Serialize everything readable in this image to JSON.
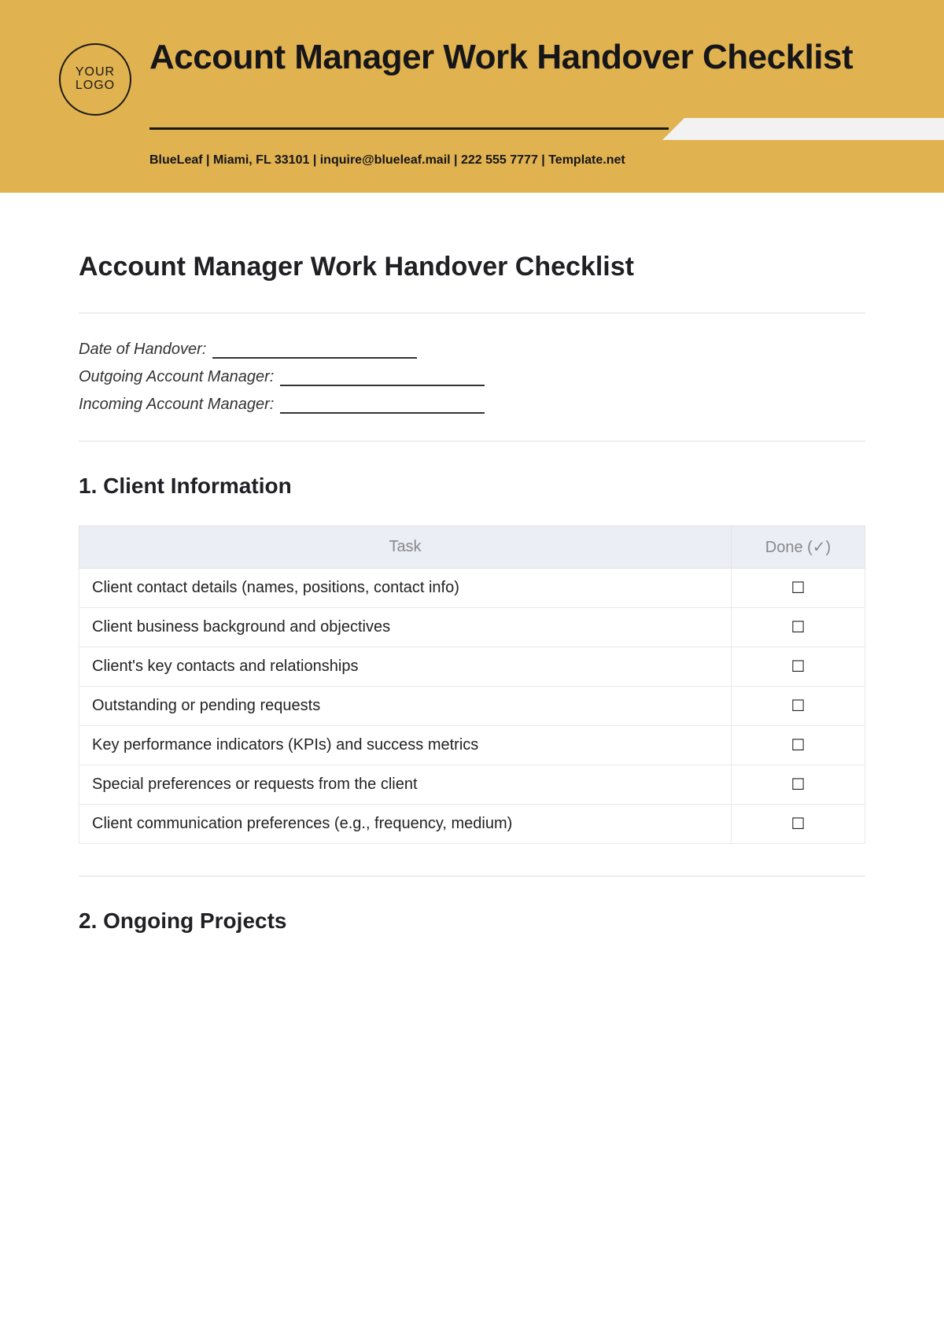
{
  "banner": {
    "logo_top": "YOUR",
    "logo_bottom": "LOGO",
    "title": "Account Manager Work Handover Checklist",
    "contact": "BlueLeaf  |  Miami, FL 33101  |  inquire@blueleaf.mail | 222 555 7777 | Template.net"
  },
  "doc": {
    "title": "Account Manager Work Handover Checklist",
    "meta": {
      "date_label": "Date of Handover:",
      "outgoing_label": "Outgoing Account Manager:",
      "incoming_label": "Incoming Account Manager:"
    },
    "table_headers": {
      "task": "Task",
      "done": "Done (✓)"
    },
    "checkbox_glyph": "☐",
    "sections": [
      {
        "heading": "1. Client Information",
        "rows": [
          "Client contact details (names, positions, contact info)",
          "Client business background and objectives",
          "Client's key contacts and relationships",
          "Outstanding or pending requests",
          "Key performance indicators (KPIs) and success metrics",
          "Special preferences or requests from the client",
          "Client communication preferences (e.g., frequency, medium)"
        ]
      },
      {
        "heading": "2. Ongoing Projects",
        "rows": []
      }
    ]
  }
}
